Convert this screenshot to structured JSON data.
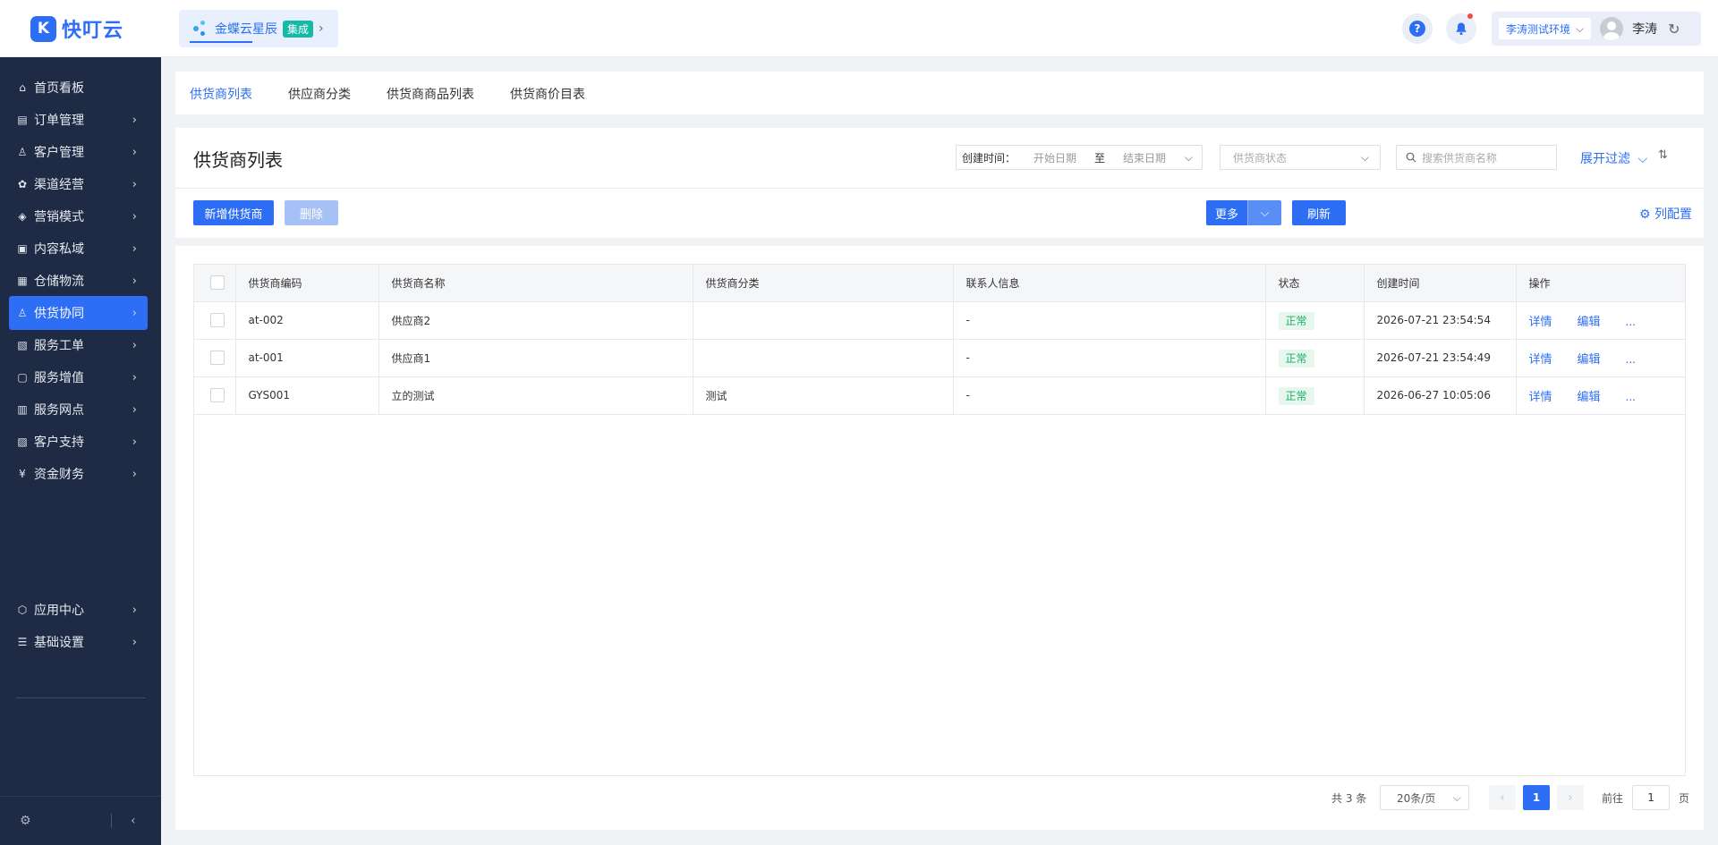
{
  "app": {
    "logo_mark": "K",
    "logo_text": "快叮云"
  },
  "integration": {
    "name": "金蝶云星辰",
    "tag": "集成",
    "chevron": "›"
  },
  "header": {
    "help_icon_glyph": "?",
    "environment": "李涛测试环境",
    "env_chevron": "⌵",
    "user_name": "李涛",
    "refresh_glyph": "↻"
  },
  "sidebar": {
    "items": [
      {
        "icon": "⌂",
        "icon_name": "home-icon",
        "label": "首页看板",
        "arrow": ""
      },
      {
        "icon": "▤",
        "icon_name": "order-icon",
        "label": "订单管理",
        "arrow": "›"
      },
      {
        "icon": "♙",
        "icon_name": "customer-icon",
        "label": "客户管理",
        "arrow": "›"
      },
      {
        "icon": "✿",
        "icon_name": "channel-icon",
        "label": "渠道经营",
        "arrow": "›"
      },
      {
        "icon": "◈",
        "icon_name": "marketing-icon",
        "label": "营销模式",
        "arrow": "›"
      },
      {
        "icon": "▣",
        "icon_name": "content-icon",
        "label": "内容私域",
        "arrow": "›"
      },
      {
        "icon": "▦",
        "icon_name": "warehouse-icon",
        "label": "仓储物流",
        "arrow": "›"
      },
      {
        "icon": "♙",
        "icon_name": "supply-icon",
        "label": "供货协同",
        "arrow": "›"
      },
      {
        "icon": "▧",
        "icon_name": "service-order-icon",
        "label": "服务工单",
        "arrow": "›"
      },
      {
        "icon": "▢",
        "icon_name": "value-added-icon",
        "label": "服务增值",
        "arrow": "›"
      },
      {
        "icon": "▥",
        "icon_name": "service-point-icon",
        "label": "服务网点",
        "arrow": "›"
      },
      {
        "icon": "▨",
        "icon_name": "support-icon",
        "label": "客户支持",
        "arrow": "›"
      },
      {
        "icon": "¥",
        "icon_name": "finance-icon",
        "label": "资金财务",
        "arrow": "›"
      },
      {
        "icon": "⬡",
        "icon_name": "app-center-icon",
        "label": "应用中心",
        "arrow": "›"
      },
      {
        "icon": "☰",
        "icon_name": "settings-icon",
        "label": "基础设置",
        "arrow": "›"
      }
    ],
    "footer_settings_glyph": "⚙",
    "footer_collapse_glyph": "‹"
  },
  "tabs": [
    {
      "label": "供货商列表"
    },
    {
      "label": "供应商分类"
    },
    {
      "label": "供货商商品列表"
    },
    {
      "label": "供货商价目表"
    }
  ],
  "page": {
    "title": "供货商列表",
    "date_label": "创建时间：",
    "date_start": "开始日期",
    "date_sep": "至",
    "date_end": "结束日期",
    "status_placeholder": "供货商状态",
    "search_placeholder": "搜索供货商名称",
    "expand_filter": "展开过滤",
    "sort_glyph": "⇅",
    "add_button": "新增供货商",
    "delete_button": "删除",
    "more_button": "更多",
    "more_chevron": "⌵",
    "refresh_button": "刷新",
    "column_config": "列配置",
    "chevron": "⌵"
  },
  "table": {
    "headers": [
      "供货商编码",
      "供货商名称",
      "供货商分类",
      "联系人信息",
      "状态",
      "创建时间",
      "操作"
    ],
    "rows": [
      {
        "code": "at-002",
        "name": "供应商2",
        "category": "",
        "contact": "-",
        "status": "正常",
        "created": "2026-07-21 23:54:54",
        "detail": "详情",
        "edit": "编辑",
        "more": "..."
      },
      {
        "code": "at-001",
        "name": "供应商1",
        "category": "",
        "contact": "-",
        "status": "正常",
        "created": "2026-07-21 23:54:49",
        "detail": "详情",
        "edit": "编辑",
        "more": "..."
      },
      {
        "code": "GYS001",
        "name": "立的测试",
        "category": "测试",
        "contact": "-",
        "status": "正常",
        "created": "2026-06-27 10:05:06",
        "detail": "详情",
        "edit": "编辑",
        "more": "..."
      }
    ]
  },
  "pagination": {
    "total": "共 3 条",
    "page_size": "20条/页",
    "prev": "‹",
    "next": "›",
    "current_page": "1",
    "goto_label": "前往",
    "goto_value": "1",
    "page_suffix": "页"
  },
  "colors": {
    "primary": "#2d6ef5",
    "sidebar_bg": "#1f2a44",
    "success": "#1fae62"
  }
}
